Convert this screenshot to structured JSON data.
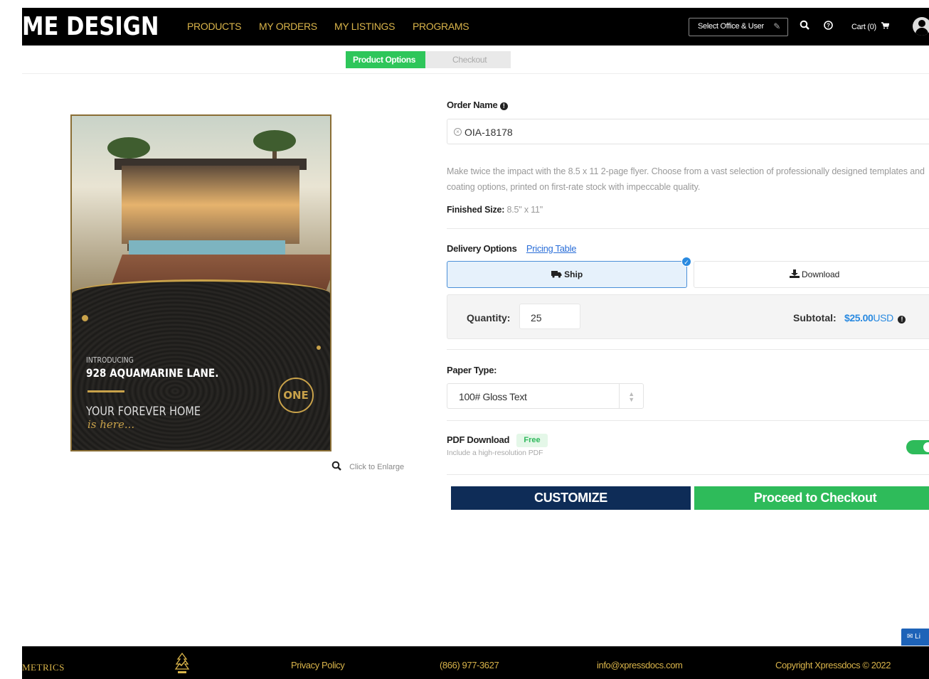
{
  "header": {
    "brand": "ME DESIGN",
    "nav": [
      "PRODUCTS",
      "MY ORDERS",
      "MY LISTINGS",
      "PROGRAMS"
    ],
    "office_button": "Select Office & User",
    "cart": "Cart (0)",
    "icons": [
      "pencil-icon",
      "search-icon",
      "help-icon",
      "cart-icon",
      "user-avatar-icon"
    ]
  },
  "steps": {
    "active": "Product Options",
    "next": "Checkout"
  },
  "preview": {
    "flyer": {
      "intro": "INTRODUCING",
      "address": "928 AQUAMARINE LANE.",
      "tagline": "YOUR FOREVER HOME",
      "script": "is here...",
      "logo": "ONE"
    },
    "enlarge_label": "Click to Enlarge"
  },
  "form": {
    "order_name_label": "Order Name",
    "order_name_value": "OIA-18178",
    "description": "Make twice the impact with the 8.5 x 11 2-page flyer. Choose from a vast selection of professionally designed templates and coating options, printed on first-rate stock with impeccable quality.",
    "finished_size_label": "Finished Size:",
    "finished_size_value": "8.5\" x 11\"",
    "delivery_label": "Delivery Options",
    "pricing_link": "Pricing Table",
    "delivery_options": [
      {
        "label": "Ship",
        "selected": true
      },
      {
        "label": "Download",
        "selected": false
      }
    ],
    "quantity_label": "Quantity:",
    "quantity_value": "25",
    "subtotal_label": "Subtotal:",
    "subtotal_amount": "$25.00",
    "subtotal_currency": "USD",
    "paper_type_label": "Paper Type:",
    "paper_type_value": "100# Gloss Text",
    "pdf_label": "PDF Download",
    "pdf_badge": "Free",
    "pdf_sub": "Include a high-resolution PDF",
    "pdf_enabled": true,
    "customize_button": "CUSTOMIZE",
    "checkout_button": "Proceed to Checkout"
  },
  "chat": {
    "label": "Li"
  },
  "footer": {
    "metrics": "METRICS",
    "privacy": "Privacy Policy",
    "phone": "(866) 977-3627",
    "email": "info@xpressdocs.com",
    "copyright": "Copyright Xpressdocs © 2022"
  },
  "colors": {
    "gold": "#d9b44a",
    "green": "#2ebb5a",
    "navy": "#0e2c57",
    "blue": "#2a8ae0"
  }
}
